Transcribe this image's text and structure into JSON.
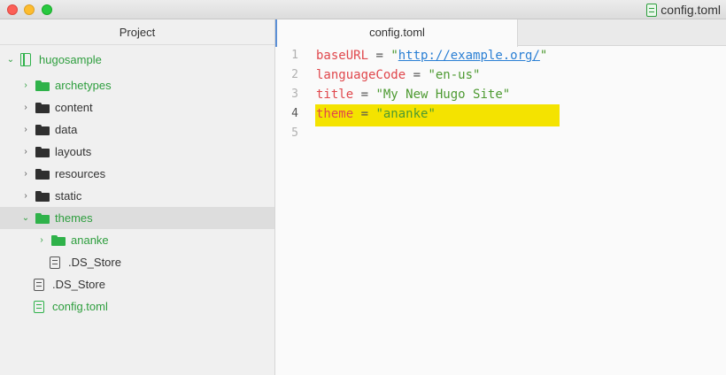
{
  "window": {
    "title": "config.toml"
  },
  "colors": {
    "accent": "#5b8fd6",
    "green": "#2fb24a",
    "highlight": "#f4e300",
    "keyword": "#e0474c",
    "string": "#4d9a31",
    "link": "#2a7fd4"
  },
  "sidebar": {
    "header": "Project",
    "items": [
      {
        "label": "hugosample",
        "icon": "repo-book-icon"
      },
      {
        "label": "archetypes",
        "icon": "folder-icon"
      },
      {
        "label": "content",
        "icon": "folder-icon"
      },
      {
        "label": "data",
        "icon": "folder-icon"
      },
      {
        "label": "layouts",
        "icon": "folder-icon"
      },
      {
        "label": "resources",
        "icon": "folder-icon"
      },
      {
        "label": "static",
        "icon": "folder-icon"
      },
      {
        "label": "themes",
        "icon": "folder-icon"
      },
      {
        "label": "ananke",
        "icon": "folder-icon"
      },
      {
        "label": ".DS_Store",
        "icon": "file-icon"
      },
      {
        "label": ".DS_Store",
        "icon": "file-icon"
      },
      {
        "label": "config.toml",
        "icon": "file-icon"
      }
    ]
  },
  "editor": {
    "tab": "config.toml",
    "lines": [
      {
        "no": "1",
        "key": "baseURL",
        "eq": " = ",
        "q1": "\"",
        "val": "http://example.org/",
        "q2": "\""
      },
      {
        "no": "2",
        "key": "languageCode",
        "eq": " = ",
        "val": "\"en-us\""
      },
      {
        "no": "3",
        "key": "title",
        "eq": " = ",
        "val": "\"My New Hugo Site\""
      },
      {
        "no": "4",
        "key": "theme",
        "eq": " = ",
        "val": "\"ananke\""
      },
      {
        "no": "5"
      }
    ]
  }
}
